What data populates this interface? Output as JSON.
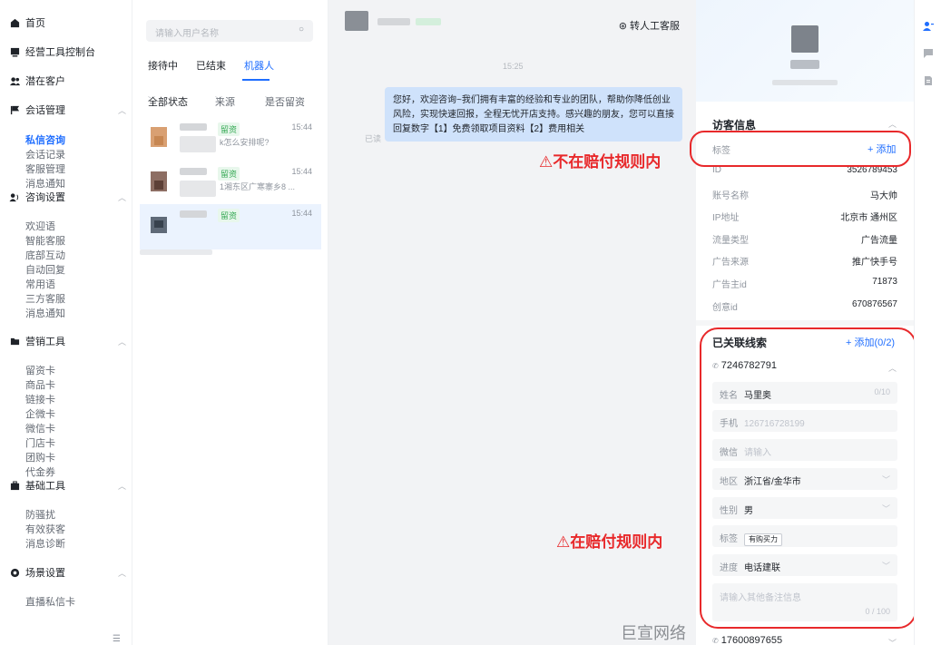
{
  "sidebar": {
    "home": "首页",
    "console": "经营工具控制台",
    "leads": "潜在客户",
    "session_mgmt": "会话管理",
    "session_items": [
      "私信咨询",
      "会话记录",
      "客服管理",
      "消息通知"
    ],
    "consult_settings": "咨询设置",
    "consult_items": [
      "欢迎语",
      "智能客服",
      "底部互动",
      "自动回复",
      "常用语",
      "三方客服",
      "消息通知"
    ],
    "marketing": "营销工具",
    "marketing_items": [
      "留资卡",
      "商品卡",
      "链接卡",
      "企微卡",
      "微信卡",
      "门店卡",
      "团购卡",
      "代金券"
    ],
    "basic_tools": "基础工具",
    "basic_items": [
      "防骚扰",
      "有效获客",
      "消息诊断"
    ],
    "scene": "场景设置",
    "scene_items": [
      "直播私信卡"
    ]
  },
  "list": {
    "search_placeholder": "请输入用户名称",
    "tabs": [
      "接待中",
      "已结束",
      "机器人"
    ],
    "active_tab": "机器人",
    "filters": [
      "全部状态",
      "来源",
      "是否留资"
    ],
    "conversations": [
      {
        "badge": "留资",
        "time": "15:44",
        "msg": "k怎么安排呢?"
      },
      {
        "badge": "留资",
        "time": "15:44",
        "msg": "1湘东区广寒寨乡8 ..."
      },
      {
        "badge": "留资",
        "time": "15:44",
        "msg": ""
      }
    ]
  },
  "chat": {
    "transfer": "转人工客服",
    "time": "15:25",
    "message": "您好，欢迎咨询~我们拥有丰富的经验和专业的团队，帮助你降低创业风险，实现快速回报，全程无忧开店支持。感兴趣的朋友，您可以直接回复数字【1】免费领取项目资料【2】费用相关",
    "read": "已读",
    "warn_not": "⚠不在赔付规则内",
    "warn_in": "⚠在赔付规则内",
    "watermark": "巨宣网络"
  },
  "visitor": {
    "title": "访客信息",
    "tag_label": "标签",
    "tag_add": "+ 添加",
    "rows": [
      {
        "k": "ID",
        "v": "3526789453"
      },
      {
        "k": "账号名称",
        "v": "马大帅"
      },
      {
        "k": "IP地址",
        "v": "北京市 通州区"
      },
      {
        "k": "流量类型",
        "v": "广告流量"
      },
      {
        "k": "广告来源",
        "v": "推广快手号"
      },
      {
        "k": "广告主id",
        "v": "71873"
      },
      {
        "k": "创意id",
        "v": "670876567"
      }
    ]
  },
  "clues": {
    "title": "已关联线索",
    "add": "+ 添加(0/2)",
    "phone1": "7246782791",
    "name_label": "姓名",
    "name_value": "马里奥",
    "name_count": "0/10",
    "mobile_label": "手机",
    "mobile_value": "126716728199",
    "wechat_label": "微信",
    "wechat_placeholder": "请输入",
    "region_label": "地区",
    "region_value": "浙江省/金华市",
    "gender_label": "性别",
    "gender_value": "男",
    "tag_label": "标签",
    "tag_value": "有购买力",
    "progress_label": "进度",
    "progress_value": "电话建联",
    "remark_placeholder": "请输入其他备注信息",
    "remark_count": "0 / 100",
    "phone2": "17600897655"
  },
  "colors": {
    "accent": "#1f6eff",
    "warning": "#e8292b",
    "leads_badge": "#34a853"
  }
}
